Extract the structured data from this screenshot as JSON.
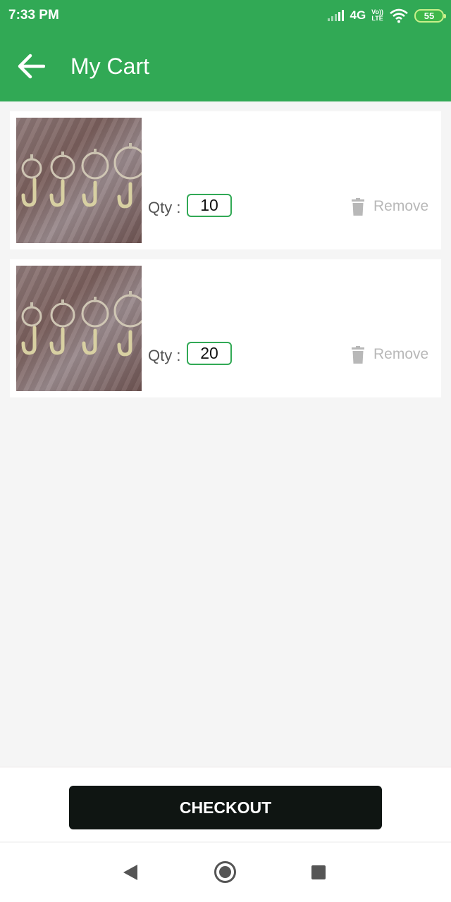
{
  "status_bar": {
    "time": "7:33 PM",
    "network": "4G",
    "volte": "Vo))",
    "lte": "LTE",
    "battery": "55"
  },
  "app_bar": {
    "title": "My Cart",
    "back_icon": "arrow-back-icon"
  },
  "cart": {
    "items": [
      {
        "qty_label": "Qty :",
        "qty": "10",
        "remove_label": "Remove"
      },
      {
        "qty_label": "Qty :",
        "qty": "20",
        "remove_label": "Remove"
      }
    ]
  },
  "checkout": {
    "label": "CHECKOUT"
  },
  "nav": {
    "back_icon": "triangle-back-icon",
    "home_icon": "circle-home-icon",
    "recents_icon": "square-recents-icon"
  },
  "colors": {
    "primary": "#31a955",
    "checkout_bg": "#0f1512",
    "muted": "#b8b8b8"
  }
}
